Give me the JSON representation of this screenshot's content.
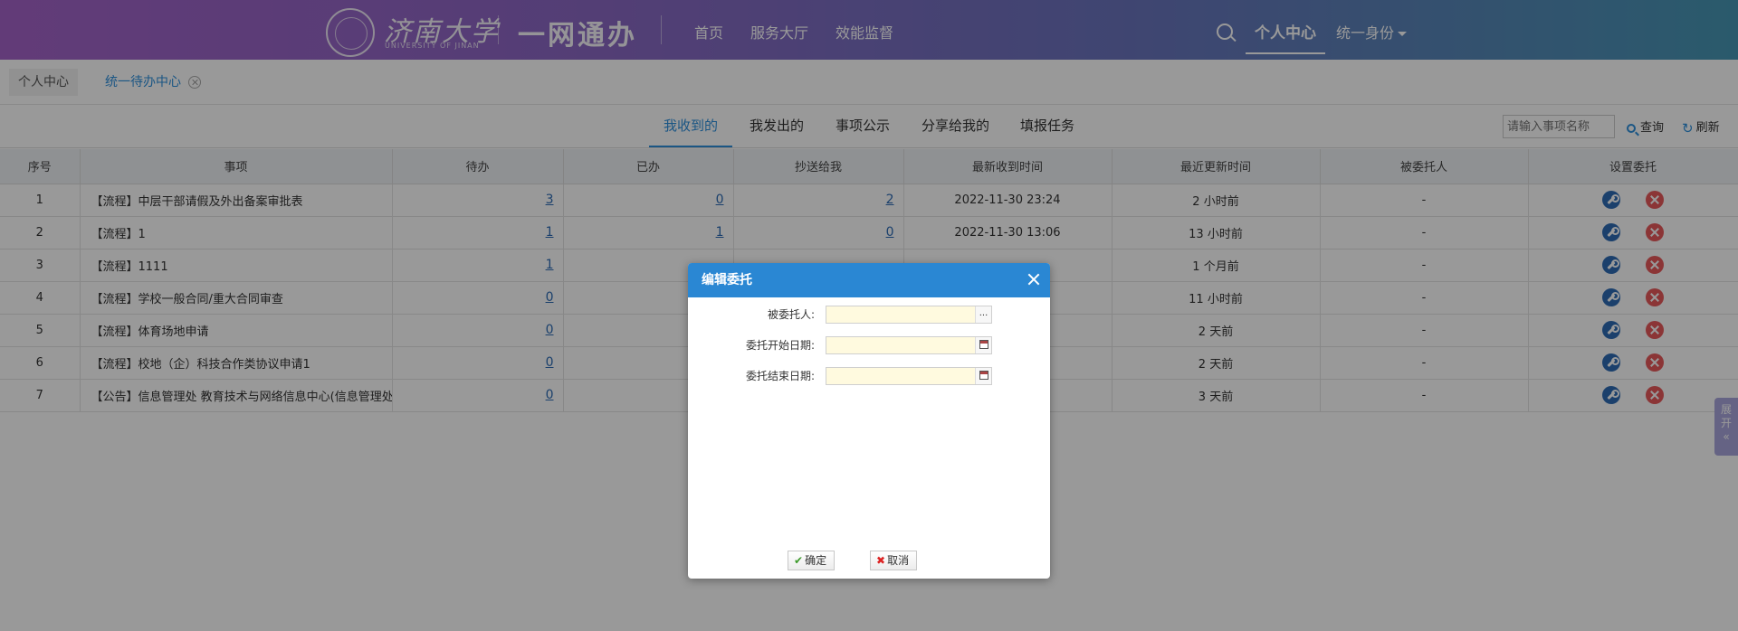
{
  "header": {
    "logo_cn": "济南大学",
    "logo_en": "UNIVERSITY OF JINAN",
    "app_name": "一网通办",
    "nav": [
      "首页",
      "服务大厅",
      "效能监督"
    ],
    "personal_center": "个人中心",
    "identity": "统一身份"
  },
  "tabs": [
    "个人中心",
    "统一待办中心"
  ],
  "subtabs": [
    "我收到的",
    "我发出的",
    "事项公示",
    "分享给我的",
    "填报任务"
  ],
  "toolbar": {
    "search_placeholder": "请输入事项名称",
    "query_label": "查询",
    "refresh_label": "刷新"
  },
  "table": {
    "columns": [
      "序号",
      "事项",
      "待办",
      "已办",
      "抄送给我",
      "最新收到时间",
      "最近更新时间",
      "被委托人",
      "设置委托"
    ],
    "rows": [
      {
        "no": "1",
        "item": "【流程】中层干部请假及外出备案审批表",
        "todo": "3",
        "done": "0",
        "cc": "2",
        "received": "2022-11-30 23:24",
        "updated": "2 小时前",
        "delegate": "-"
      },
      {
        "no": "2",
        "item": "【流程】1",
        "todo": "1",
        "done": "1",
        "cc": "0",
        "received": "2022-11-30 13:06",
        "updated": "13 小时前",
        "delegate": "-"
      },
      {
        "no": "3",
        "item": "【流程】1111",
        "todo": "1",
        "done": "",
        "cc": "",
        "received": "",
        "updated": "1 个月前",
        "delegate": "-"
      },
      {
        "no": "4",
        "item": "【流程】学校一般合同/重大合同审查",
        "todo": "0",
        "done": "",
        "cc": "",
        "received": "",
        "updated": "11 小时前",
        "delegate": "-"
      },
      {
        "no": "5",
        "item": "【流程】体育场地申请",
        "todo": "0",
        "done": "",
        "cc": "",
        "received": "",
        "updated": "2 天前",
        "delegate": "-"
      },
      {
        "no": "6",
        "item": "【流程】校地（企）科技合作类协议申请1",
        "todo": "0",
        "done": "",
        "cc": "",
        "received": "",
        "updated": "2 天前",
        "delegate": "-"
      },
      {
        "no": "7",
        "item": "【公告】信息管理处 教育技术与网络信息中心(信息管理处 ...",
        "todo": "0",
        "done": "",
        "cc": "",
        "received": "",
        "updated": "3 天前",
        "delegate": "-"
      }
    ]
  },
  "side_expand": [
    "展",
    "开",
    "«"
  ],
  "dialog": {
    "title": "编辑委托",
    "fields": [
      {
        "label": "被委托人:",
        "value": "",
        "button": "..."
      },
      {
        "label": "委托开始日期:",
        "value": ""
      },
      {
        "label": "委托结束日期:",
        "value": ""
      }
    ],
    "ok_label": "确定",
    "cancel_label": "取消"
  },
  "colors": {
    "header_gradient_start": "#a463c9",
    "header_gradient_end": "#4797b5",
    "accent": "#2d8fdd",
    "dialog_title_bg": "#2a87d3",
    "delete_red": "#e8595b"
  }
}
